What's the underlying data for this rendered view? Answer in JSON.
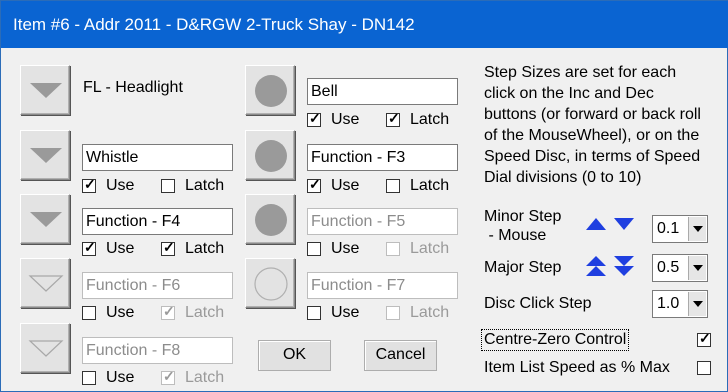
{
  "window": {
    "title": "Item #6 - Addr 2011 - D&RGW 2-Truck Shay - DN142"
  },
  "functions": {
    "f0": {
      "name": "FL - Headlight"
    },
    "f1": {
      "name": "Bell",
      "use": "Use",
      "latch": "Latch"
    },
    "f2": {
      "name": "Whistle",
      "use": "Use",
      "latch": "Latch"
    },
    "f3": {
      "name": "Function - F3",
      "use": "Use",
      "latch": "Latch"
    },
    "f4": {
      "name": "Function - F4",
      "use": "Use",
      "latch": "Latch"
    },
    "f5": {
      "name": "Function - F5",
      "use": "Use",
      "latch": "Latch"
    },
    "f6": {
      "name": "Function - F6",
      "use": "Use",
      "latch": "Latch"
    },
    "f7": {
      "name": "Function - F7",
      "use": "Use",
      "latch": "Latch"
    },
    "f8": {
      "name": "Function - F8",
      "use": "Use",
      "latch": "Latch"
    }
  },
  "buttons": {
    "ok": "OK",
    "cancel": "Cancel"
  },
  "steps": {
    "description": [
      "Step Sizes are set for each",
      "click on the Inc and Dec",
      "buttons (or forward or back roll",
      "of the MouseWheel), or on the",
      "Speed Disc, in terms of Speed",
      "Dial divisions (0 to 10)"
    ],
    "minor_label_1": "Minor Step",
    "minor_label_2": " - Mouse",
    "minor_value": "0.1",
    "major_label": "Major Step",
    "major_value": "0.5",
    "disc_label": "Disc Click Step",
    "disc_value": "1.0"
  },
  "options": {
    "centre_zero_label": "Centre-Zero Control",
    "centre_zero_checked": true,
    "item_list_label": "Item List Speed as % Max",
    "item_list_checked": false
  },
  "icons": [
    "triangle-down-icon",
    "circle-icon",
    "arrow-up-icon",
    "arrow-down-icon",
    "double-arrow-up-icon",
    "double-arrow-down-icon",
    "checkmark-icon",
    "chevron-down-icon"
  ],
  "colors": {
    "title_bar": "#0a64d2",
    "arrow_blue": "#1f3fe0",
    "icon_gray": "#9a9a9a"
  }
}
